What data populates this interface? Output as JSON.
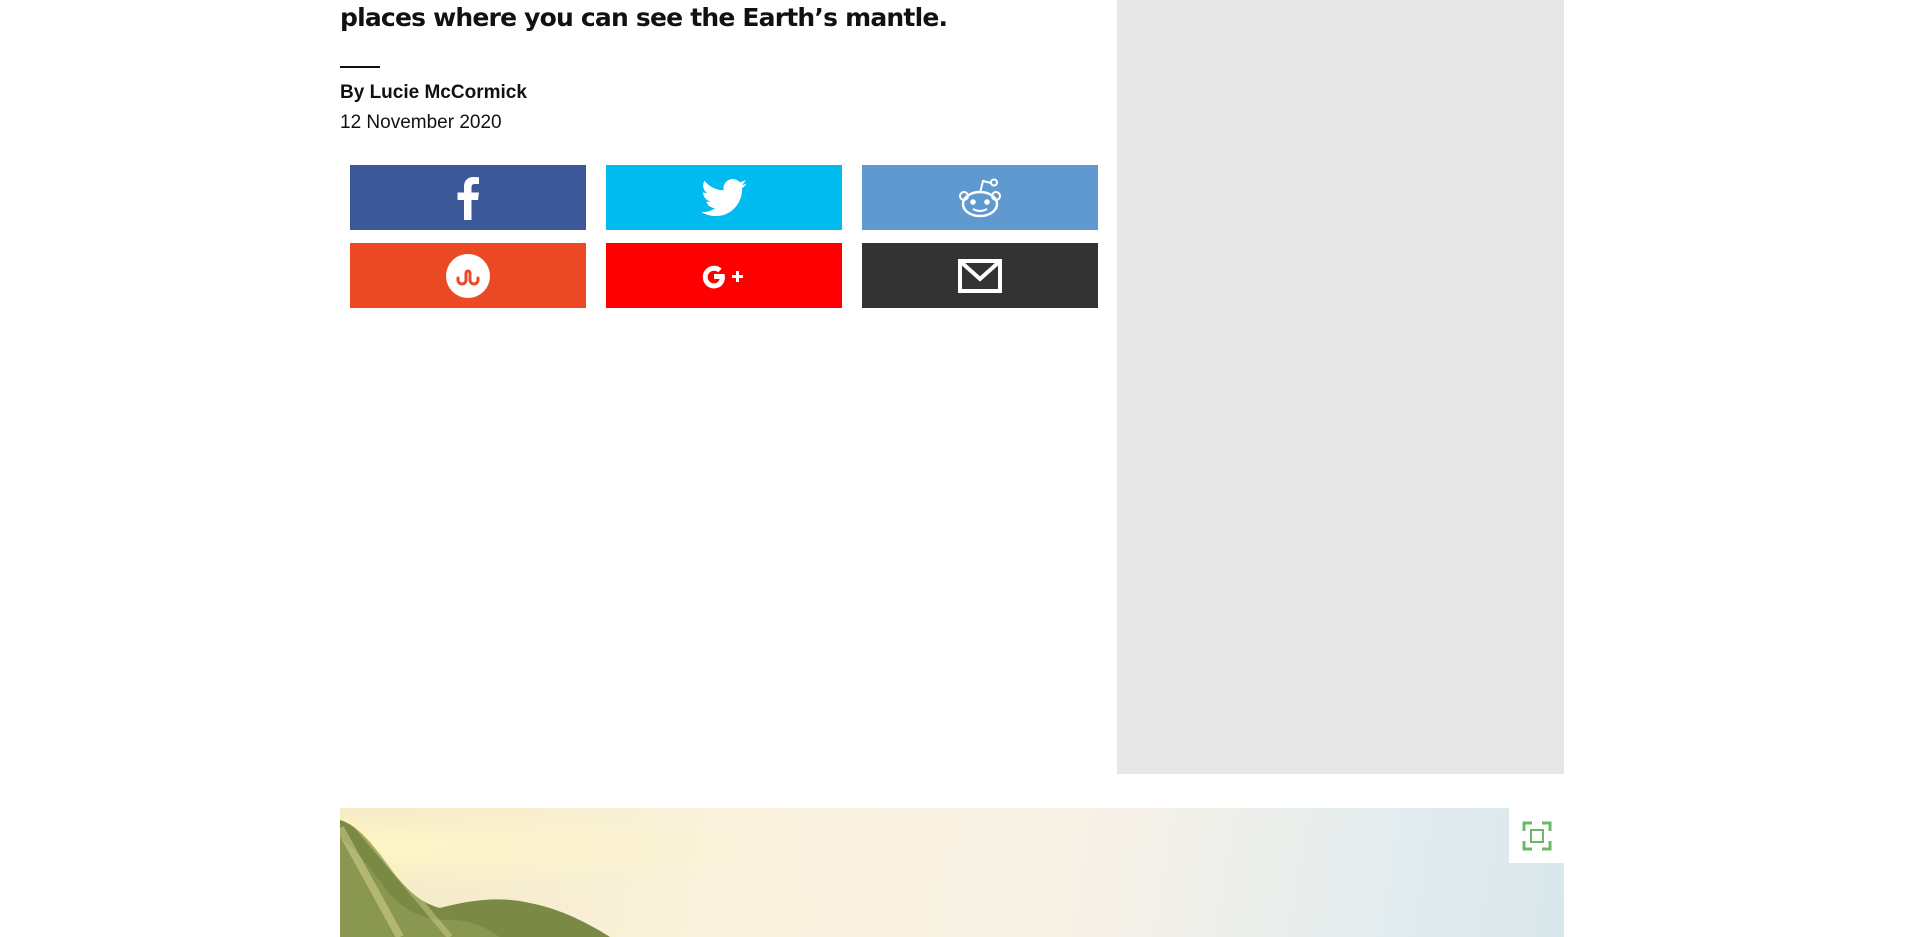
{
  "article": {
    "subtitle": "places where you can see the Earth’s mantle.",
    "byline": "By Lucie McCormick",
    "date": "12 November 2020"
  },
  "share": {
    "buttons": [
      {
        "network": "facebook",
        "icon": "facebook-icon",
        "color": "#3b5998"
      },
      {
        "network": "twitter",
        "icon": "twitter-icon",
        "color": "#00bbf0"
      },
      {
        "network": "reddit",
        "icon": "reddit-icon",
        "color": "#5f99cf"
      },
      {
        "network": "stumbleupon",
        "icon": "stumbleupon-icon",
        "color": "#eb4924"
      },
      {
        "network": "google-plus",
        "icon": "google-plus-icon",
        "color": "#ff0000"
      },
      {
        "network": "email",
        "icon": "email-icon",
        "color": "#333333"
      }
    ]
  },
  "hero": {
    "expand_icon": "expand-icon",
    "expand_icon_color": "#6cb86a"
  },
  "colors": {
    "ad_placeholder": "#e7e7e7",
    "text": "#111111"
  }
}
